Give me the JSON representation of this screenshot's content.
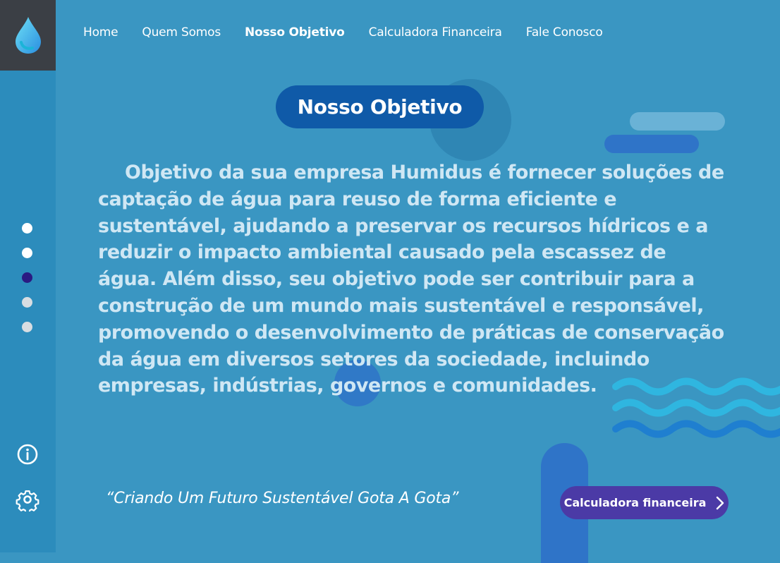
{
  "nav": {
    "items": [
      {
        "label": "Home",
        "active": false
      },
      {
        "label": "Quem Somos",
        "active": false
      },
      {
        "label": "Nosso Objetivo",
        "active": true
      },
      {
        "label": "Calculadora Financeira",
        "active": false
      },
      {
        "label": "Fale Conosco",
        "active": false
      }
    ]
  },
  "sidebar": {
    "logo_icon": "water-drop-icon",
    "dots": [
      {
        "color": "#ffffff",
        "active": false
      },
      {
        "color": "#ffffff",
        "active": false
      },
      {
        "color": "#2a1a82",
        "active": true
      },
      {
        "color": "#d8dde2",
        "active": false
      },
      {
        "color": "#d8dde2",
        "active": false
      }
    ],
    "info_icon": "info-icon",
    "settings_icon": "gear-icon"
  },
  "main": {
    "title": "Nosso Objetivo",
    "body": "Objetivo da sua empresa Humidus é fornecer soluções de captação de água para reuso de forma eficiente e sustentável, ajudando a preservar os recursos hídricos e a reduzir o impacto ambiental causado pela escassez de água. Além disso, seu objetivo pode ser contribuir para a construção de um mundo mais sustentável e responsável, promovendo o desenvolvimento de práticas de conservação da água em diversos setores da sociedade, incluindo empresas, indústrias, governos e comunidades.",
    "quote": "“Criando Um Futuro Sustentável Gota A Gota”",
    "cta_label": "Calculadora financeira",
    "cta_icon": "chevron-right-icon"
  },
  "colors": {
    "background": "#3a96c2",
    "sidebar": "#2c8cbc",
    "logo_box": "#3b3f45",
    "title_pill": "#0f5aa8",
    "cta": "#4b3aa6"
  }
}
